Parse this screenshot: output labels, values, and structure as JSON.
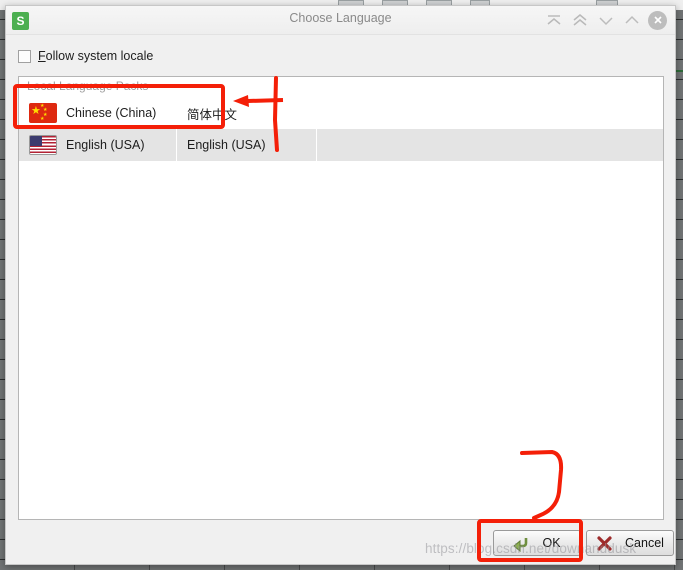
{
  "window": {
    "app_icon_letter": "S",
    "title": "Choose Language",
    "controls": [
      {
        "name": "collapse-top-icon",
        "glyph": "top-chevron"
      },
      {
        "name": "chevron-double-up-icon",
        "glyph": "double-up"
      },
      {
        "name": "chevron-down-icon",
        "glyph": "down"
      },
      {
        "name": "chevron-up-icon",
        "glyph": "up"
      },
      {
        "name": "close-icon",
        "glyph": "x"
      }
    ]
  },
  "options": {
    "follow_system_locale": {
      "label_mnemonic": "F",
      "label_rest": "ollow system locale",
      "checked": false
    }
  },
  "list": {
    "group_header": "Local Language Packs",
    "rows": [
      {
        "flag": "flag-china",
        "name": "Chinese (China)",
        "native_name": "简体中文",
        "selected": false
      },
      {
        "flag": "flag-usa",
        "name": "English (USA)",
        "native_name": "English (USA)",
        "selected": true
      }
    ]
  },
  "buttons": {
    "ok": {
      "label": "OK",
      "icon": "green-return-arrow-icon"
    },
    "cancel": {
      "label": "Cancel",
      "icon": "red-x-icon"
    }
  },
  "watermark": {
    "text": "https://blog.csdn.net/downanddusk"
  },
  "annotations": {
    "color": "#f41f08",
    "items": [
      {
        "name": "highlight-box-chinese-row",
        "kind": "rectangle"
      },
      {
        "name": "arrow-pointing-to-chinese-row",
        "kind": "arrow-left"
      },
      {
        "name": "vertical-line-marker",
        "kind": "line"
      },
      {
        "name": "highlight-box-ok-button",
        "kind": "rectangle"
      },
      {
        "name": "hook-curve-to-ok-button",
        "kind": "curve"
      }
    ]
  },
  "colors": {
    "annotation_red": "#f41f08",
    "accent_green": "#4caf50",
    "flag_china_red": "#de2910",
    "flag_china_yellow": "#ffde00",
    "selected_row_bg": "#e4e4e4",
    "dialog_bg": "#f0f0f0"
  }
}
